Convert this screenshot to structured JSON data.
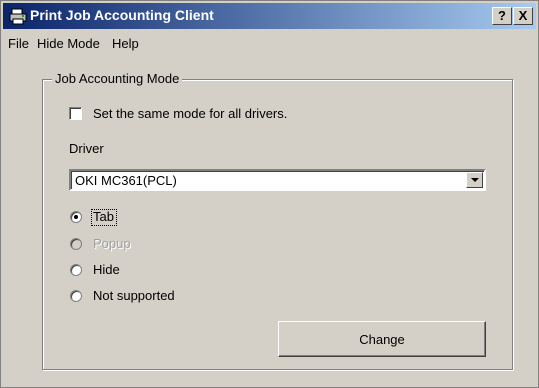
{
  "window": {
    "title": "Print Job Accounting Client",
    "help_button": "?",
    "close_button": "X"
  },
  "menu": [
    "File",
    "Hide Mode",
    "Help"
  ],
  "group": {
    "label": "Job Accounting Mode",
    "same_mode_checkbox": {
      "label": "Set the same mode for all drivers.",
      "checked": false
    },
    "driver_label": "Driver",
    "driver_value": "OKI MC361(PCL)",
    "options": [
      {
        "label": "Tab",
        "selected": true,
        "enabled": true
      },
      {
        "label": "Popup",
        "selected": false,
        "enabled": false
      },
      {
        "label": "Hide",
        "selected": false,
        "enabled": true
      },
      {
        "label": "Not supported",
        "selected": false,
        "enabled": true
      }
    ],
    "change_button": "Change"
  },
  "icons": {
    "app": "printer-icon"
  }
}
